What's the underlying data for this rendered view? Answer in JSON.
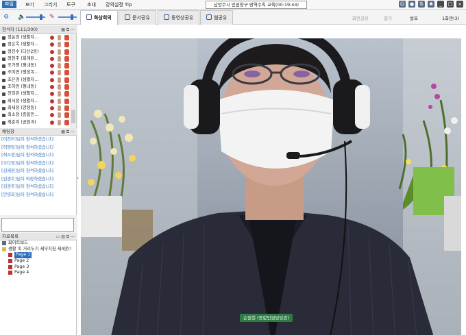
{
  "menu": {
    "items": [
      "파일",
      "보기",
      "그리기",
      "도구",
      "초대",
      "강의설정 Tip"
    ]
  },
  "window_title": "남양주시 민원창구 방역수칙 교육(00:19:44)",
  "tabs": [
    {
      "label": "화상회의"
    },
    {
      "label": "문서공유"
    },
    {
      "label": "동영상공유"
    },
    {
      "label": "웹공유"
    }
  ],
  "right_tools": {
    "share_screen": "화면공유",
    "open": "열기",
    "present": "발표",
    "screen_count": "1화면(3)"
  },
  "participants": {
    "header": "참석자 (111/300)",
    "rows": [
      "정윤경 (생활자…",
      "정은옥 (생활자…",
      "정진수 (다산2동)",
      "정현주 (회계된…",
      "조가영 (평내동)",
      "조미연 (행정복…",
      "조은경 (생활자…",
      "조하연 (평내동)",
      "진희란 (생활자…",
      "최서정 (생활자…",
      "최세정 (양정동)",
      "최소정 (종합민…",
      "최춘희 (공원과)"
    ]
  },
  "chat": {
    "header": "채팅창",
    "lines": [
      "[이진아]님이 참석하셨습니다",
      "[허영임]님이 참석하셨습니다",
      "[최소정]님이 참석하셨습니다",
      "[오다정]님이 참석하셨습니다",
      "[김세원]님이 참석하셨습니다",
      "[김경주]님이 퇴장하셨습니다",
      "[김경주]님이 참석하셨습니다",
      "[안영희]님이 참석하셨습니다"
    ],
    "input_value": ""
  },
  "files": {
    "header": "자료목록",
    "items": [
      {
        "label": "화이트보드",
        "level": 0
      },
      {
        "label": "생활 속 거리두기 세부지침 제4판(!",
        "level": 0
      },
      {
        "label": "Page 1",
        "level": 1,
        "selected": true
      },
      {
        "label": "Page 2",
        "level": 1
      },
      {
        "label": "Page 3",
        "level": 1
      },
      {
        "label": "Page 4",
        "level": 1
      }
    ]
  },
  "video": {
    "caption": "손원철 (종합민원담당관)"
  }
}
